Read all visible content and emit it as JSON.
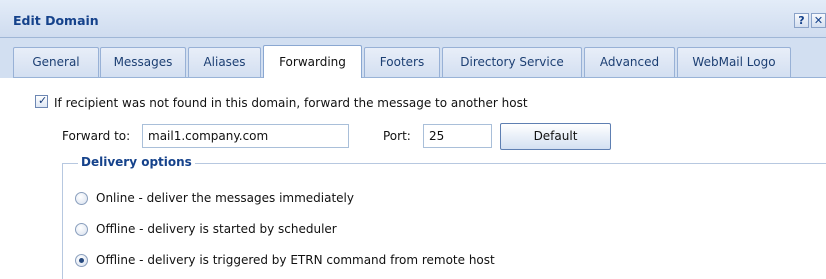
{
  "window": {
    "title": "Edit Domain",
    "help_glyph": "?",
    "close_glyph": "✕"
  },
  "tabs": [
    {
      "label": "General"
    },
    {
      "label": "Messages"
    },
    {
      "label": "Aliases"
    },
    {
      "label": "Forwarding",
      "active": true
    },
    {
      "label": "Footers"
    },
    {
      "label": "Directory Service"
    },
    {
      "label": "Advanced"
    },
    {
      "label": "WebMail Logo"
    }
  ],
  "forwarding": {
    "enable_checkbox": {
      "checked": true,
      "label": "If recipient was not found in this domain, forward the message to another host"
    },
    "forward_to": {
      "label": "Forward to:",
      "value": "mail1.company.com"
    },
    "port": {
      "label": "Port:",
      "value": "25"
    },
    "default_button": "Default",
    "delivery_options": {
      "title": "Delivery options",
      "options": [
        {
          "label": "Online - deliver the messages immediately",
          "selected": false
        },
        {
          "label": "Offline - delivery is started by scheduler",
          "selected": false
        },
        {
          "label": "Offline - delivery is triggered by ETRN command from remote host",
          "selected": true
        }
      ]
    }
  },
  "colors": {
    "title": "#15428b",
    "tab_strip": "#d2dff1",
    "window_background": "#ffffff"
  }
}
